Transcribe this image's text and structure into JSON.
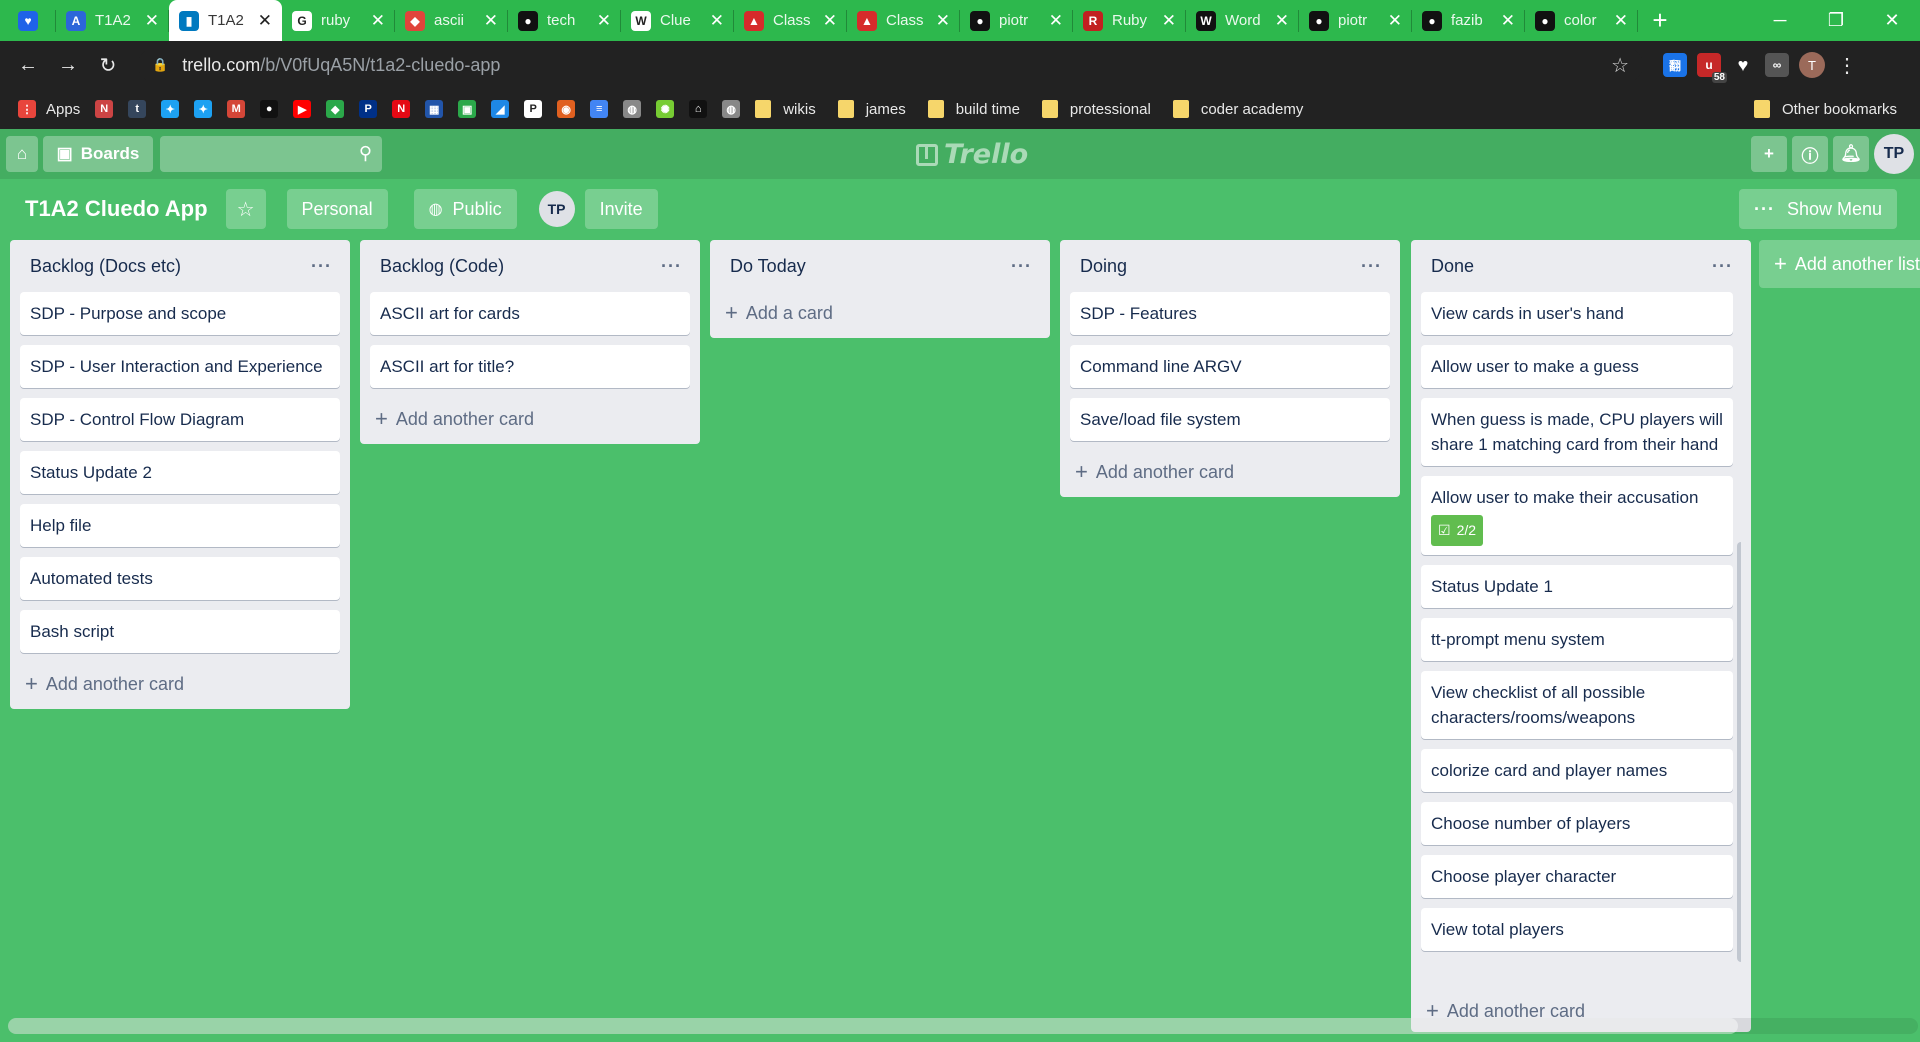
{
  "browser": {
    "tabs": [
      {
        "title": "",
        "fav_color": "#1f63e8",
        "fav_glyph": "♥",
        "icon": "vpn-icon"
      },
      {
        "title": "T1A2",
        "fav_color": "#2c66d9",
        "fav_glyph": "A",
        "icon": "app-icon"
      },
      {
        "title": "T1A2",
        "fav_color": "#0079bf",
        "fav_glyph": "▮",
        "icon": "trello-icon",
        "active": true
      },
      {
        "title": "ruby",
        "fav_color": "#ffffff",
        "fav_glyph": "G",
        "icon": "google-icon"
      },
      {
        "title": "ascii",
        "fav_color": "#e0443b",
        "fav_glyph": "◆",
        "icon": "shield-icon"
      },
      {
        "title": "tech",
        "fav_color": "#111111",
        "fav_glyph": "●",
        "icon": "github-icon"
      },
      {
        "title": "Clue",
        "fav_color": "#ffffff",
        "fav_glyph": "W",
        "icon": "wikipedia-icon"
      },
      {
        "title": "Class",
        "fav_color": "#d62b2b",
        "fav_glyph": "▲",
        "icon": "ruby-doc-icon"
      },
      {
        "title": "Class",
        "fav_color": "#d62b2b",
        "fav_glyph": "▲",
        "icon": "ruby-doc-icon"
      },
      {
        "title": "piotr",
        "fav_color": "#111111",
        "fav_glyph": "●",
        "icon": "github-icon"
      },
      {
        "title": "Ruby",
        "fav_color": "#c22020",
        "fav_glyph": "R",
        "icon": "ruby-icon"
      },
      {
        "title": "Word",
        "fav_color": "#111111",
        "fav_glyph": "W",
        "icon": "w-icon"
      },
      {
        "title": "piotr",
        "fav_color": "#111111",
        "fav_glyph": "●",
        "icon": "github-icon"
      },
      {
        "title": "fazib",
        "fav_color": "#111111",
        "fav_glyph": "●",
        "icon": "github-icon"
      },
      {
        "title": "color",
        "fav_color": "#111111",
        "fav_glyph": "●",
        "icon": "github-icon"
      }
    ],
    "url_host": "trello.com",
    "url_path": "/b/V0fUqA5N/t1a2-cluedo-app",
    "profile_letter": "T",
    "ext_badge": "58",
    "bookmarks": [
      {
        "label": "Apps",
        "color": "#e8453c",
        "glyph": "⋮",
        "icon": "apps-icon"
      },
      {
        "label": "",
        "color": "#c44",
        "glyph": "N",
        "icon": "notion-icon"
      },
      {
        "label": "",
        "color": "#35465c",
        "glyph": "t",
        "icon": "tumblr-icon"
      },
      {
        "label": "",
        "color": "#1da1f2",
        "glyph": "✦",
        "icon": "twitter-icon"
      },
      {
        "label": "",
        "color": "#1da1f2",
        "glyph": "✦",
        "icon": "twitter-icon"
      },
      {
        "label": "",
        "color": "#d44638",
        "glyph": "M",
        "icon": "gmail-icon"
      },
      {
        "label": "",
        "color": "#111",
        "glyph": "●",
        "icon": "bomb-icon"
      },
      {
        "label": "",
        "color": "#f00",
        "glyph": "▶",
        "icon": "youtube-icon"
      },
      {
        "label": "",
        "color": "#2ba84a",
        "glyph": "◆",
        "icon": "diamond-icon"
      },
      {
        "label": "",
        "color": "#003087",
        "glyph": "P",
        "icon": "paypal-icon"
      },
      {
        "label": "",
        "color": "#e50914",
        "glyph": "N",
        "icon": "netflix-icon"
      },
      {
        "label": "",
        "color": "#2255aa",
        "glyph": "▦",
        "icon": "calendar-icon"
      },
      {
        "label": "",
        "color": "#2ba84a",
        "glyph": "▣",
        "icon": "sheet-icon"
      },
      {
        "label": "",
        "color": "#1e88e5",
        "glyph": "◢",
        "icon": "arrow-icon"
      },
      {
        "label": "",
        "color": "#ffffff",
        "glyph": "P",
        "icon": "pt-icon"
      },
      {
        "label": "",
        "color": "#e06020",
        "glyph": "◉",
        "icon": "ball-icon"
      },
      {
        "label": "",
        "color": "#4285f4",
        "glyph": "≡",
        "icon": "docs-icon"
      },
      {
        "label": "",
        "color": "#888",
        "glyph": "◍",
        "icon": "globe-icon"
      },
      {
        "label": "",
        "color": "#7c3",
        "glyph": "✺",
        "icon": "bug-icon"
      },
      {
        "label": "",
        "color": "#111",
        "glyph": "⌂",
        "icon": "house-icon"
      },
      {
        "label": "",
        "color": "#888",
        "glyph": "◍",
        "icon": "globe-icon"
      }
    ],
    "bookmark_folders": [
      "wikis",
      "james",
      "build time",
      "protessional",
      "coder academy"
    ],
    "other_bookmarks": "Other bookmarks"
  },
  "trello": {
    "boards_label": "Boards",
    "logo_text": "Trello",
    "user_initials": "TP"
  },
  "board": {
    "title": "T1A2 Cluedo App",
    "personal_label": "Personal",
    "public_label": "Public",
    "member_initials": "TP",
    "invite_label": "Invite",
    "show_menu_label": "Show Menu",
    "add_list_label": "Add another list"
  },
  "lists": [
    {
      "name": "Backlog (Docs etc)",
      "cards": [
        "SDP - Purpose and scope",
        "SDP - User Interaction and Experience",
        "SDP - Control Flow Diagram",
        "Status Update 2",
        "Help file",
        "Automated tests",
        "Bash script"
      ],
      "add_label": "Add another card"
    },
    {
      "name": "Backlog (Code)",
      "cards": [
        "ASCII art for cards",
        "ASCII art for title?"
      ],
      "add_label": "Add another card"
    },
    {
      "name": "Do Today",
      "cards": [],
      "add_label": "Add a card"
    },
    {
      "name": "Doing",
      "cards": [
        "SDP - Features",
        "Command line ARGV",
        "Save/load file system"
      ],
      "add_label": "Add another card"
    },
    {
      "name": "Done",
      "cards": [
        "View cards in user's hand",
        "Allow user to make a guess",
        "When guess is made, CPU players will share 1 matching card from their hand",
        "Allow user to make their accusation",
        "Status Update 1",
        "tt-prompt menu system",
        "View checklist of all possible characters/rooms/weapons",
        "colorize card and player names",
        "Choose number of players",
        "Choose player character",
        "View total players"
      ],
      "checklist_card_index": 3,
      "checklist_badge": "2/2",
      "add_label": "Add another card"
    }
  ]
}
